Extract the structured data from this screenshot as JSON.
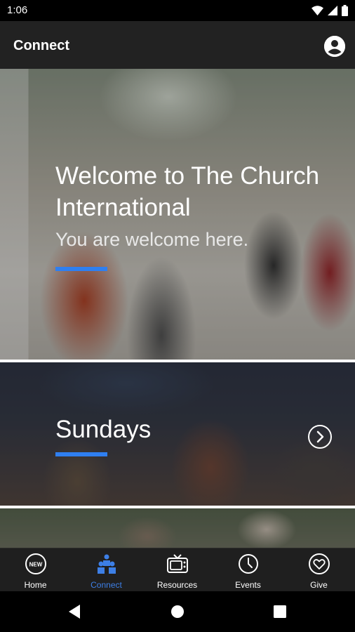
{
  "status_bar": {
    "time": "1:06",
    "icons": [
      "wifi-icon",
      "signal-icon",
      "battery-icon"
    ]
  },
  "app_bar": {
    "title": "Connect",
    "profile_icon": "account-circle-icon"
  },
  "hero": {
    "title": "Welcome to The Church International",
    "subtitle": "You are welcome here.",
    "accent_color": "#2f7ff0"
  },
  "cards": [
    {
      "title": "Sundays",
      "arrow_icon": "chevron-right-circle-icon"
    }
  ],
  "tab_bar": {
    "active_color": "#3d7fe6",
    "tabs": [
      {
        "label": "Home",
        "icon": "new-badge-icon",
        "active": false
      },
      {
        "label": "Connect",
        "icon": "people-icon",
        "active": true
      },
      {
        "label": "Resources",
        "icon": "tv-icon",
        "active": false
      },
      {
        "label": "Events",
        "icon": "clock-icon",
        "active": false
      },
      {
        "label": "Give",
        "icon": "heart-icon",
        "active": false
      }
    ]
  },
  "nav_bar": {
    "buttons": [
      "back-icon",
      "home-circle-icon",
      "recents-square-icon"
    ]
  }
}
